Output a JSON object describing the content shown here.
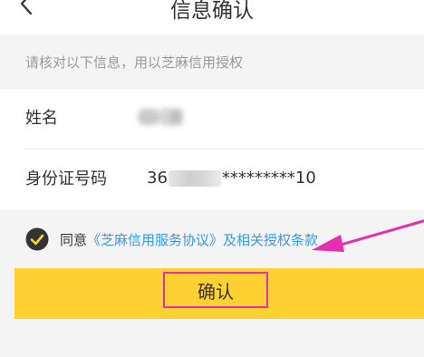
{
  "header": {
    "title": "信息确认",
    "back_icon": "chevron-left-icon"
  },
  "notice": {
    "text": "请核对以下信息，用以芝麻信用授权"
  },
  "fields": {
    "name_label": "姓名",
    "id_label": "身份证号码",
    "id_prefix": "36",
    "id_suffix": "*********10"
  },
  "agreement": {
    "prefix": "同意",
    "link_text": "《芝麻信用服务协议》及相关授权条款",
    "checked": true,
    "check_color": "#333333",
    "check_mark_color": "#ffd232"
  },
  "confirm": {
    "label": "确认",
    "button_color": "#ffd232",
    "highlight_color": "#e62fb0"
  },
  "annotation": {
    "arrow_color": "#e62fb0"
  }
}
